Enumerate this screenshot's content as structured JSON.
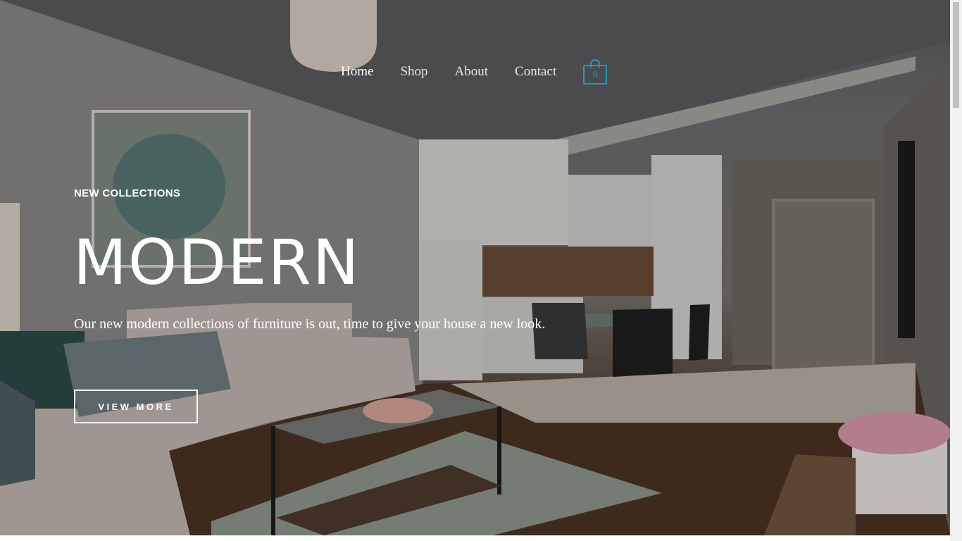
{
  "nav": {
    "items": [
      {
        "label": "Home",
        "active": true
      },
      {
        "label": "Shop",
        "active": false
      },
      {
        "label": "About",
        "active": false
      },
      {
        "label": "Contact",
        "active": false
      }
    ],
    "cart_count": "0"
  },
  "hero": {
    "eyebrow": "NEW COLLECTIONS",
    "headline": "MODERN",
    "subtext": "Our new modern collections of furniture is out, time to give your house a new look.",
    "cta_label": "VIEW MORE"
  },
  "colors": {
    "accent": "#1e9bb7",
    "text_on_image": "#ffffff"
  },
  "icons": {
    "cart": "shopping-bag-icon"
  }
}
